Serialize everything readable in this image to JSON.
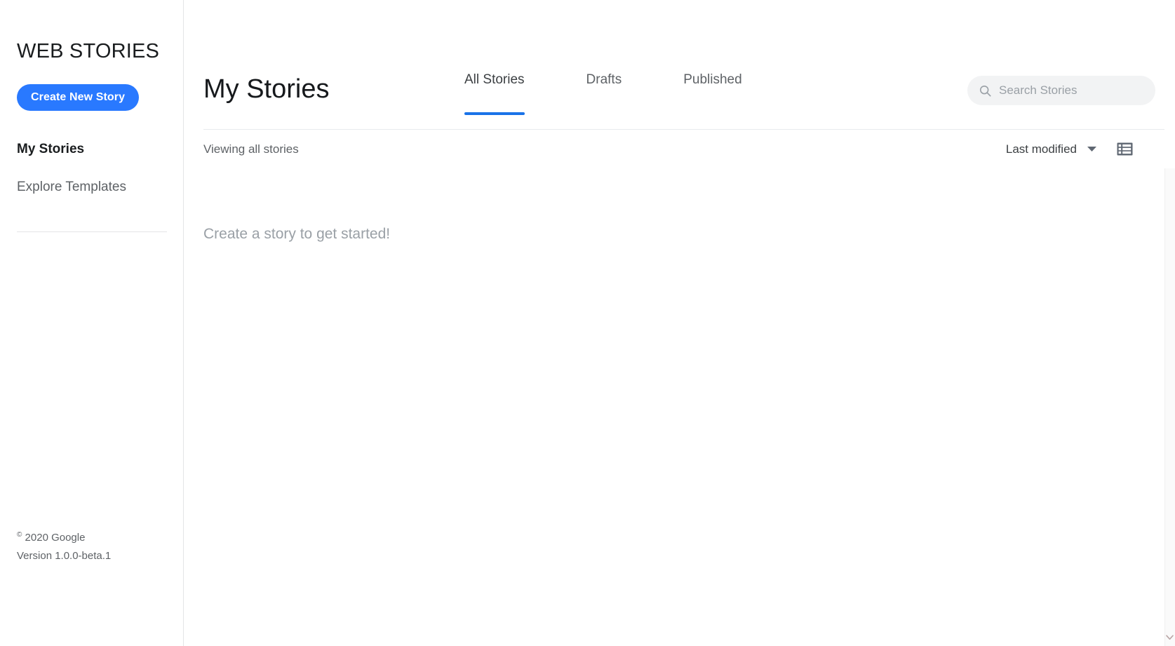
{
  "sidebar": {
    "brand": "WEB STORIES",
    "create_button": "Create New Story",
    "nav": [
      {
        "label": "My Stories",
        "active": true
      },
      {
        "label": "Explore Templates",
        "active": false
      }
    ],
    "footer": {
      "copyright_mark": "©",
      "copyright": " 2020 Google",
      "version": "Version 1.0.0-beta.1"
    }
  },
  "header": {
    "title": "My Stories",
    "tabs": [
      {
        "label": "All Stories",
        "active": true
      },
      {
        "label": "Drafts",
        "active": false
      },
      {
        "label": "Published",
        "active": false
      }
    ],
    "search": {
      "placeholder": "Search Stories",
      "value": "",
      "icon": "search-icon"
    }
  },
  "toolbar": {
    "viewing_label": "Viewing all stories",
    "sort_label": "Last modified",
    "sort_icon": "chevron-down-icon",
    "view_toggle_icon": "list-view-icon"
  },
  "content": {
    "empty_message": "Create a story to get started!"
  },
  "scrollbar": {
    "down_arrow_icon": "chevron-down-icon"
  },
  "colors": {
    "accent_blue": "#2979ff",
    "tab_underline": "#1a73e8",
    "text_primary": "#1a1d1f",
    "text_secondary": "#5e6266",
    "text_muted": "#9aa0a6",
    "border": "#e4e5e6",
    "search_bg": "#f2f3f4",
    "icon_slate": "#5f6772"
  }
}
